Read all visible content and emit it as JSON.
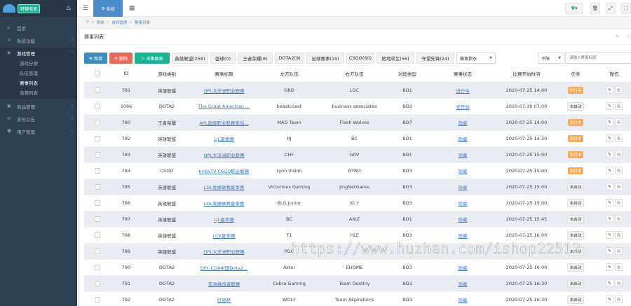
{
  "sidebar": {
    "logo_text": "轩辕电竞",
    "menu": [
      {
        "icon": "home-icon",
        "label": "首页"
      },
      {
        "icon": "gear-icon",
        "label": "系统功能"
      },
      {
        "icon": "gamepad-icon",
        "label": "游戏管理"
      },
      {
        "icon": "shop-icon",
        "label": "商品管理"
      },
      {
        "icon": "announce-icon",
        "label": "发布公告"
      },
      {
        "icon": "users-icon",
        "label": "用户管理"
      }
    ],
    "submenu": [
      "游戏分类",
      "队伍管理",
      "赛事列表",
      "竞猜列表"
    ]
  },
  "topbar": {
    "tab_label": "系统"
  },
  "breadcrumb": [
    "系统",
    "游戏管理",
    "赛事列表"
  ],
  "panel": {
    "title": "赛事列表"
  },
  "toolbar": {
    "add_label": "新增",
    "delete_label": "删除",
    "collect_label": "采集赛事",
    "filters": [
      "英雄联盟(258)",
      "篮球(0)",
      "王者荣耀(8)",
      "DOTA2(9)",
      "足球赛事(19)",
      "CSGO(60)",
      "绝地求生(56)",
      "守望先锋(24)"
    ],
    "status_select": "赛事状态",
    "scope_select": "不限",
    "search_placeholder": "请输入赛事标题"
  },
  "table": {
    "headers": [
      "ID",
      "游戏类别",
      "赛事标题",
      "左方队伍",
      "右方队伍",
      "对局类型",
      "赛事状态",
      "比赛开始时间",
      "任务",
      "操作"
    ],
    "rows": [
      {
        "id": "781",
        "category": "英雄联盟",
        "title": "OPL大洋洲职业联赛",
        "left": "ORD",
        "right": "LGC",
        "type": "BO1",
        "status": "进行中",
        "time": "2020-07-25 14:00",
        "task": "执行中"
      },
      {
        "id": "1086",
        "category": "DOTA2",
        "title": "The Great American ...",
        "left": "beastcoast",
        "right": "business associates",
        "type": "BO2",
        "status": "未开始",
        "time": "2020-07-30 07:00",
        "task": "未启动"
      },
      {
        "id": "780",
        "category": "王者荣耀",
        "title": "APL超级职业联赛季后...",
        "left": "MAD Team",
        "right": "Flash Wolves",
        "type": "BO7",
        "status": "隐藏",
        "time": "2020-07-25 14:00",
        "task": "执行中"
      },
      {
        "id": "782",
        "category": "英雄联盟",
        "title": "LJL夏季赛",
        "left": "RJ",
        "right": "BC",
        "type": "BO1",
        "status": "隐藏",
        "time": "2020-07-25 14:30",
        "task": "执行中"
      },
      {
        "id": "783",
        "category": "英雄联盟",
        "title": "OPL大洋洲职业联赛",
        "left": "CHF",
        "right": "GRV",
        "type": "BO1",
        "status": "隐藏",
        "time": "2020-07-25 15:00",
        "task": "执行中"
      },
      {
        "id": "784",
        "category": "CSGO",
        "title": "ImbaTV CSGO职业联赛",
        "left": "Lynn Vision",
        "right": "BTRG",
        "type": "BO3",
        "status": "隐藏",
        "time": "2020-07-25 15:00",
        "task": "执行中"
      },
      {
        "id": "785",
        "category": "英雄联盟",
        "title": "LDL发展联赛夏季赛",
        "left": "Victorious Gaming",
        "right": "JingNetGame",
        "type": "BO3",
        "status": "隐藏",
        "time": "2020-07-25 15:00",
        "task": "未启动"
      },
      {
        "id": "786",
        "category": "英雄联盟",
        "title": "LDL发展联赛夏季赛",
        "left": "BLG Junior",
        "right": "IG.Y",
        "type": "BO3",
        "status": "隐藏",
        "time": "2020-07-25 15:00",
        "task": "未启动"
      },
      {
        "id": "787",
        "category": "英雄联盟",
        "title": "LJL夏季赛",
        "left": "BC",
        "right": "AXIZ",
        "type": "BO1",
        "status": "隐藏",
        "time": "2020-07-25 15:45",
        "task": "未启动"
      },
      {
        "id": "788",
        "category": "英雄联盟",
        "title": "LCK夏季赛",
        "left": "T1",
        "right": "HLE",
        "type": "BO3",
        "status": "隐藏",
        "time": "2020-07-25 16:00",
        "task": "未启动"
      },
      {
        "id": "789",
        "category": "英雄联盟",
        "title": "OPL大洋洲职业联赛",
        "left": "PGG",
        "right": "",
        "type": "",
        "status": "",
        "time": "",
        "task": "未启动"
      },
      {
        "id": "790",
        "category": "DOTA2",
        "title": "DPL-CDA中国Dota2...",
        "left": "Aster",
        "right": "EHOME",
        "type": "BO3",
        "status": "隐藏",
        "time": "2020-07-25 16:00",
        "task": "未启动"
      },
      {
        "id": "791",
        "category": "DOTA2",
        "title": "亚洲挑战者联赛",
        "left": "Cobra Gaming",
        "right": "Team Destiny",
        "type": "BO3",
        "status": "隐藏",
        "time": "2020-07-25 16:30",
        "task": "未启动"
      },
      {
        "id": "792",
        "category": "DOTA2",
        "title": "红星杯",
        "left": "WOLF",
        "right": "Team Aspirations",
        "type": "BO3",
        "status": "隐藏",
        "time": "2020-07-25 16:30",
        "task": "未启动"
      }
    ]
  },
  "watermark": "https://www.huzhan.com/ishop22512"
}
